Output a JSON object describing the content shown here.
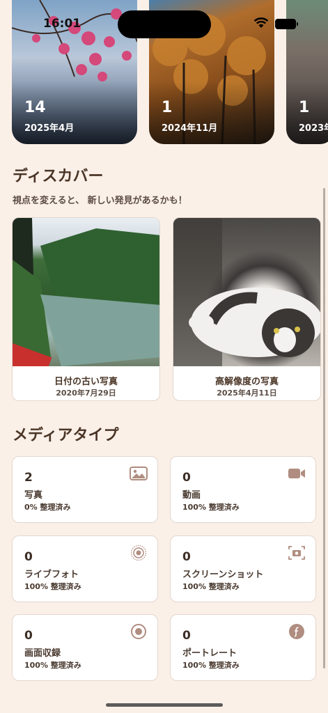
{
  "status": {
    "time": "16:01"
  },
  "albums": [
    {
      "count": "14",
      "date": "2025年4月"
    },
    {
      "count": "1",
      "date": "2024年11月"
    },
    {
      "count": "1",
      "date": "2023年"
    }
  ],
  "discover": {
    "title": "ディスカバー",
    "subtitle": "視点を変えると、 新しい発見があるかも！",
    "cards": [
      {
        "title": "日付の古い写真",
        "date": "2020年7月29日"
      },
      {
        "title": "高解像度の写真",
        "date": "2025年4月11日"
      }
    ]
  },
  "media": {
    "title": "メディアタイプ",
    "items": [
      {
        "count": "2",
        "label": "写真",
        "status": "0% 整理済み",
        "icon": "photo-icon"
      },
      {
        "count": "0",
        "label": "動画",
        "status": "100% 整理済み",
        "icon": "video-icon"
      },
      {
        "count": "0",
        "label": "ライブフォト",
        "status": "100% 整理済み",
        "icon": "live-photo-icon"
      },
      {
        "count": "0",
        "label": "スクリーンショット",
        "status": "100% 整理済み",
        "icon": "screenshot-icon"
      },
      {
        "count": "0",
        "label": "画面収録",
        "status": "100% 整理済み",
        "icon": "screen-record-icon"
      },
      {
        "count": "0",
        "label": "ポートレート",
        "status": "100% 整理済み",
        "icon": "portrait-icon"
      }
    ]
  },
  "colors": {
    "background": "#fbf0e8",
    "icon": "#b08d80",
    "text": "#4a3526"
  }
}
